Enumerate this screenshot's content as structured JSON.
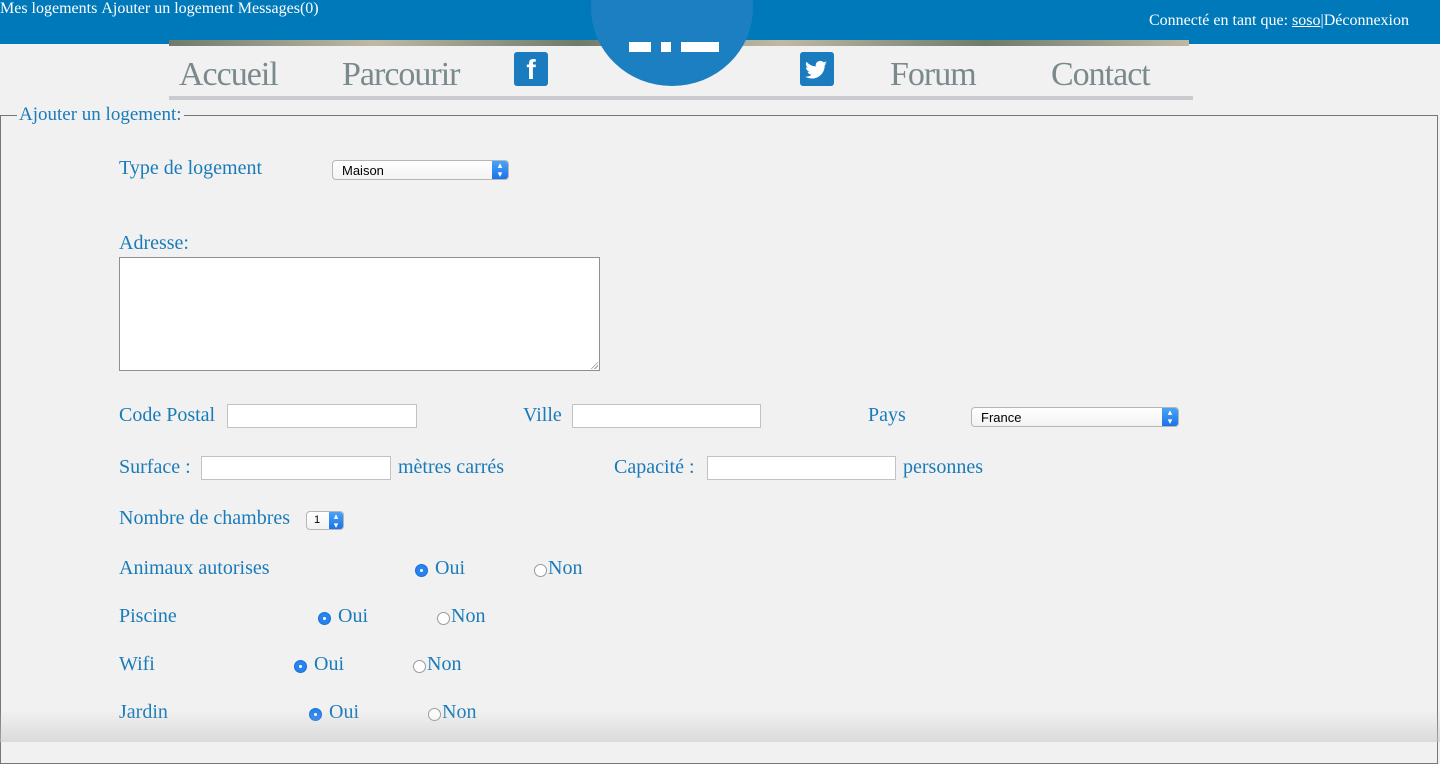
{
  "topbar": {
    "links": [
      "Mes logements",
      "Ajouter un logement",
      "Messages(0)"
    ],
    "connected_label": "Connecté en tant que:",
    "username": "soso",
    "separator": "|",
    "logout": "Déconnexion"
  },
  "nav": {
    "items": [
      "Accueil",
      "Parcourir",
      "Forum",
      "Contact"
    ],
    "facebook_glyph": "f",
    "twitter_glyph": "🐦"
  },
  "form": {
    "legend": "Ajouter un logement:",
    "type_label": "Type de logement",
    "type_value": "Maison",
    "address_label": "Adresse:",
    "postal_label": "Code Postal",
    "city_label": "Ville",
    "country_label": "Pays",
    "country_value": "France",
    "surface_label": "Surface :",
    "surface_unit": "mètres carrés",
    "capacity_label": "Capacité :",
    "capacity_unit": "personnes",
    "rooms_label": "Nombre de chambres",
    "rooms_value": "1",
    "rows": [
      {
        "label": "Animaux autorises",
        "yes": "Oui",
        "no": "Non",
        "selected": "Oui"
      },
      {
        "label": "Piscine",
        "yes": "Oui",
        "no": "Non",
        "selected": "Oui"
      },
      {
        "label": "Wifi",
        "yes": "Oui",
        "no": "Non",
        "selected": "Oui"
      },
      {
        "label": "Jardin",
        "yes": "Oui",
        "no": "Non",
        "selected": "Oui"
      }
    ]
  },
  "colors": {
    "topbar": "#0079ba",
    "accent": "#1a7bb9",
    "nav_text": "#7a8a8c",
    "background": "#f1f1f1"
  },
  "icons": [
    "facebook-icon",
    "twitter-icon",
    "select-arrow-icon",
    "resize-grip-icon"
  ]
}
